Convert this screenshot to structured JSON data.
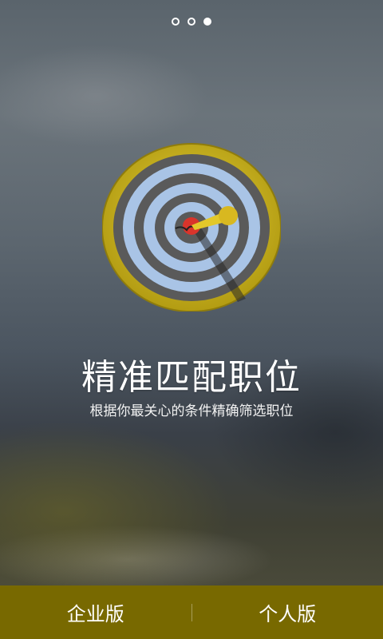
{
  "pager": {
    "total": 3,
    "active_index": 3
  },
  "main": {
    "title": "精准匹配职位",
    "subtitle": "根据你最关心的条件精确筛选职位",
    "icon": "dartboard-icon"
  },
  "bottom_bar": {
    "enterprise_label": "企业版",
    "personal_label": "个人版",
    "color": "#786900"
  },
  "colors": {
    "target_rim": "#c9b21f",
    "target_dark": "#5a5a5a",
    "target_light": "#a9c4e6",
    "bullseye": "#d9342b",
    "dart": "#e3c82a"
  }
}
